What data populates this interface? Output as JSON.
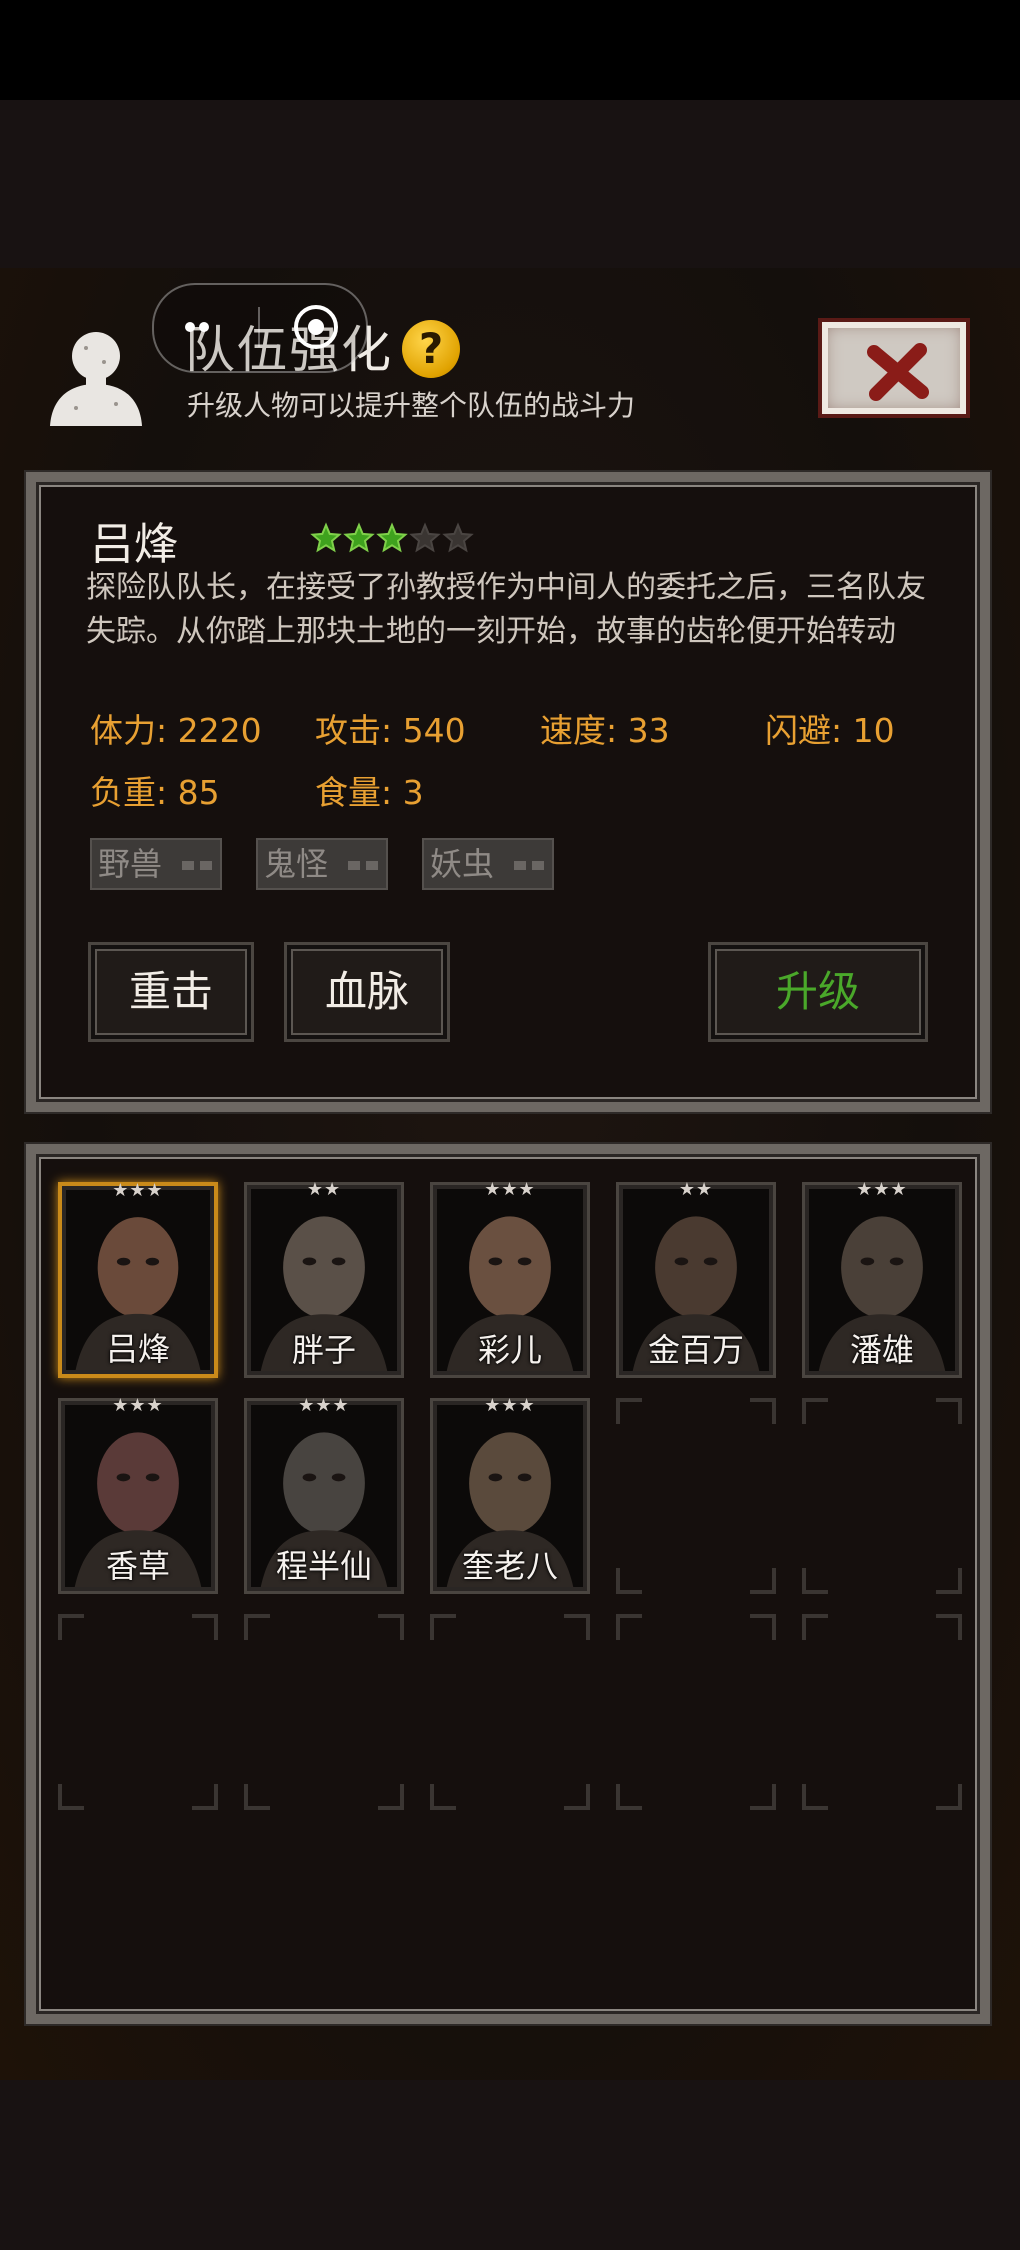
{
  "header": {
    "title": "队伍强化",
    "subtitle": "升级人物可以提升整个队伍的战斗力"
  },
  "character": {
    "name": "吕烽",
    "stars_filled": 3,
    "stars_total": 5,
    "description": "探险队队长，在接受了孙教授作为中间人的委托之后，三名队友失踪。从你踏上那块土地的一刻开始，故事的齿轮便开始转动",
    "stats": {
      "hp": "体力: 2220",
      "attack": "攻击: 540",
      "speed": "速度: 33",
      "dodge": "闪避: 10",
      "load": "负重: 85",
      "food": "食量: 3"
    },
    "traits": [
      "野兽",
      "鬼怪",
      "妖虫"
    ]
  },
  "buttons": {
    "heavy_strike": "重击",
    "bloodline": "血脉",
    "upgrade": "升级"
  },
  "roster": [
    {
      "name": "吕烽",
      "stars": "★★★",
      "selected": true
    },
    {
      "name": "胖子",
      "stars": "★★"
    },
    {
      "name": "彩儿",
      "stars": "★★★"
    },
    {
      "name": "金百万",
      "stars": "★★"
    },
    {
      "name": "潘雄",
      "stars": "★★★"
    },
    {
      "name": "香草",
      "stars": "★★★"
    },
    {
      "name": "程半仙",
      "stars": "★★★"
    },
    {
      "name": "奎老八",
      "stars": "★★★"
    }
  ],
  "colors": {
    "stat_orange": "#e8a032",
    "star_green": "#3fa21e",
    "upgrade_green": "#4aa82a",
    "frame_gray": "#6d6863",
    "selected_gold": "#c98a1a"
  }
}
